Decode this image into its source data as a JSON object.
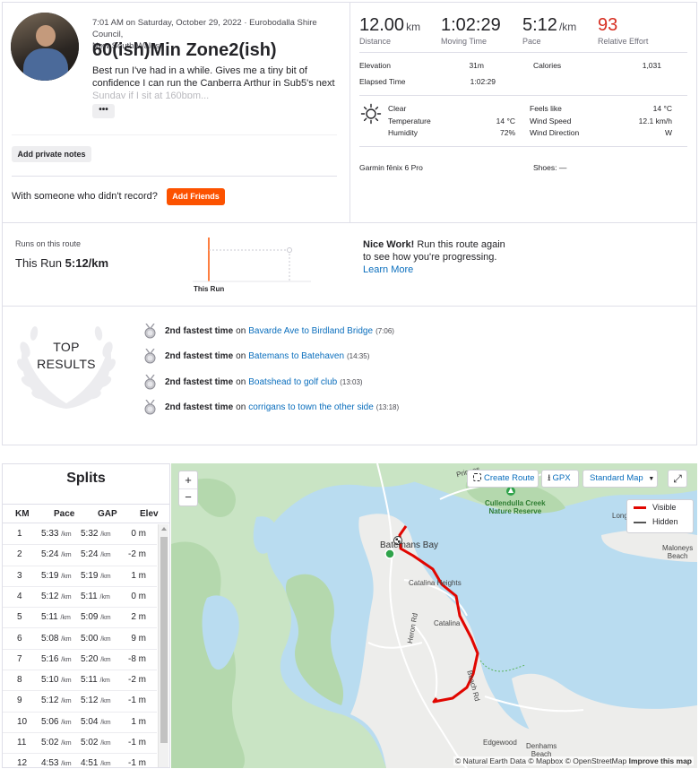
{
  "activity": {
    "meta_line1": "7:01 AM on Saturday, October 29, 2022 · Eurobodalla Shire Council,",
    "meta_line2": "New South Wales",
    "title": "60(ish)Min Zone2(ish)",
    "description": "Best run I've had in a while. Gives me a tiny bit of confidence I can run the Canberra Arthur in Sub5's next",
    "description_faded": "Sunday if I sit at 160bpm...",
    "more_label": "•••",
    "private_notes_label": "Add private notes",
    "someone_text": "With someone who didn't record?",
    "add_friends_label": "Add Friends"
  },
  "stats": {
    "distance": {
      "value": "12.00",
      "unit": "km",
      "label": "Distance"
    },
    "moving_time": {
      "value": "1:02:29",
      "label": "Moving Time"
    },
    "pace": {
      "value": "5:12",
      "unit": "/km",
      "label": "Pace"
    },
    "relative_effort": {
      "value": "93",
      "label": "Relative Effort",
      "color": "#d62d20"
    },
    "elevation_label": "Elevation",
    "elevation": "31m",
    "calories_label": "Calories",
    "calories": "1,031",
    "elapsed_label": "Elapsed Time",
    "elapsed": "1:02:29"
  },
  "weather": {
    "condition": "Clear",
    "temperature_label": "Temperature",
    "temperature": "14 °C",
    "humidity_label": "Humidity",
    "humidity": "72%",
    "feels_like_label": "Feels like",
    "feels_like": "14 °C",
    "wind_speed_label": "Wind Speed",
    "wind_speed": "12.1 km/h",
    "wind_direction_label": "Wind Direction",
    "wind_direction": "W"
  },
  "gear": {
    "device": "Garmin fēnix 6 Pro",
    "shoes": "Shoes: —"
  },
  "route": {
    "runs_label": "Runs on this route",
    "this_run_prefix": "This Run",
    "this_run_pace": "5:12/km",
    "bar_label": "This Run",
    "nice_bold": "Nice Work!",
    "nice_text": "Run this route again to see how you're progressing.",
    "learn_more": "Learn More"
  },
  "top_results": {
    "line1": "TOP",
    "line2": "RESULTS",
    "items": [
      {
        "bold": "2nd fastest time",
        "on": "on",
        "segment": "Bavarde Ave to Birdland Bridge",
        "time": "(7:06)"
      },
      {
        "bold": "2nd fastest time",
        "on": "on",
        "segment": "Batemans to Batehaven",
        "time": "(14:35)"
      },
      {
        "bold": "2nd fastest time",
        "on": "on",
        "segment": "Boatshead to golf club",
        "time": "(13:03)"
      },
      {
        "bold": "2nd fastest time",
        "on": "on",
        "segment": "corrigans to town the other side",
        "time": "(13:18)"
      }
    ]
  },
  "splits": {
    "title": "Splits",
    "headers": {
      "km": "KM",
      "pace": "Pace",
      "gap": "GAP",
      "elev": "Elev"
    },
    "unit": "/km",
    "rows": [
      {
        "km": "1",
        "pace": "5:33",
        "gap": "5:32",
        "elev": "0 m"
      },
      {
        "km": "2",
        "pace": "5:24",
        "gap": "5:24",
        "elev": "-2 m"
      },
      {
        "km": "3",
        "pace": "5:19",
        "gap": "5:19",
        "elev": "1 m"
      },
      {
        "km": "4",
        "pace": "5:12",
        "gap": "5:11",
        "elev": "0 m"
      },
      {
        "km": "5",
        "pace": "5:11",
        "gap": "5:09",
        "elev": "2 m"
      },
      {
        "km": "6",
        "pace": "5:08",
        "gap": "5:00",
        "elev": "9 m"
      },
      {
        "km": "7",
        "pace": "5:16",
        "gap": "5:20",
        "elev": "-8 m"
      },
      {
        "km": "8",
        "pace": "5:10",
        "gap": "5:11",
        "elev": "-2 m"
      },
      {
        "km": "9",
        "pace": "5:12",
        "gap": "5:12",
        "elev": "-1 m"
      },
      {
        "km": "10",
        "pace": "5:06",
        "gap": "5:04",
        "elev": "1 m"
      },
      {
        "km": "11",
        "pace": "5:02",
        "gap": "5:02",
        "elev": "-1 m"
      },
      {
        "km": "12",
        "pace": "4:53",
        "gap": "4:51",
        "elev": "-1 m"
      }
    ]
  },
  "map": {
    "zoom_in": "+",
    "zoom_out": "−",
    "create_route": "Create Route",
    "gpx": "GPX",
    "map_type": "Standard Map",
    "legend_visible": "Visible",
    "legend_hidden": "Hidden",
    "route_color": "#e10600",
    "labels": {
      "batemans_bay": "Batemans Bay",
      "catalina_heights": "Catalina Heights",
      "catalina": "Catalina",
      "cullendulla": "Cullendulla Creek",
      "cullendulla2": "Nature Reserve",
      "maloneys": "Maloneys",
      "maloneys2": "Beach",
      "edgewood": "Edgewood",
      "denhams": "Denhams",
      "denhams2": "Beach",
      "heron_rd": "Heron Rd",
      "beach_rd": "Beach Rd",
      "princes": "Princes",
      "long": "Long"
    },
    "credit_plain": "© Natural Earth Data © Mapbox © OpenStreetMap",
    "credit_bold": "Improve this map"
  }
}
